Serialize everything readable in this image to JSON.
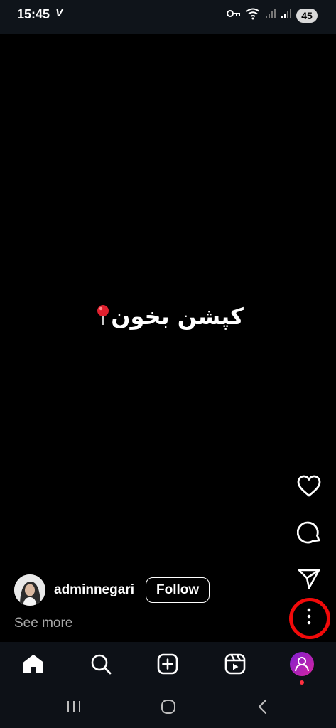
{
  "status_bar": {
    "time": "15:45",
    "carrier_icon": "V",
    "battery": "45",
    "icons": [
      "key-icon",
      "wifi-icon",
      "signal-icon",
      "signal-icon-2",
      "battery-icon"
    ]
  },
  "reel": {
    "caption": "کپشن بخون",
    "caption_icon": "pin-icon"
  },
  "actions": {
    "like_icon": "heart-icon",
    "comment_icon": "comment-icon",
    "share_icon": "paper-plane-icon",
    "more_icon": "more-vertical-icon",
    "highlight_color": "#f10a0a"
  },
  "author": {
    "username": "adminnegari",
    "follow_label": "Follow",
    "see_more_label": "See more"
  },
  "bottom_nav": {
    "items": [
      "home-icon",
      "search-icon",
      "create-icon",
      "reels-icon",
      "profile-avatar"
    ],
    "notification_color": "#ff3040"
  },
  "system_nav": {
    "items": [
      "recent-apps-icon",
      "home-circle-icon",
      "back-icon"
    ]
  }
}
